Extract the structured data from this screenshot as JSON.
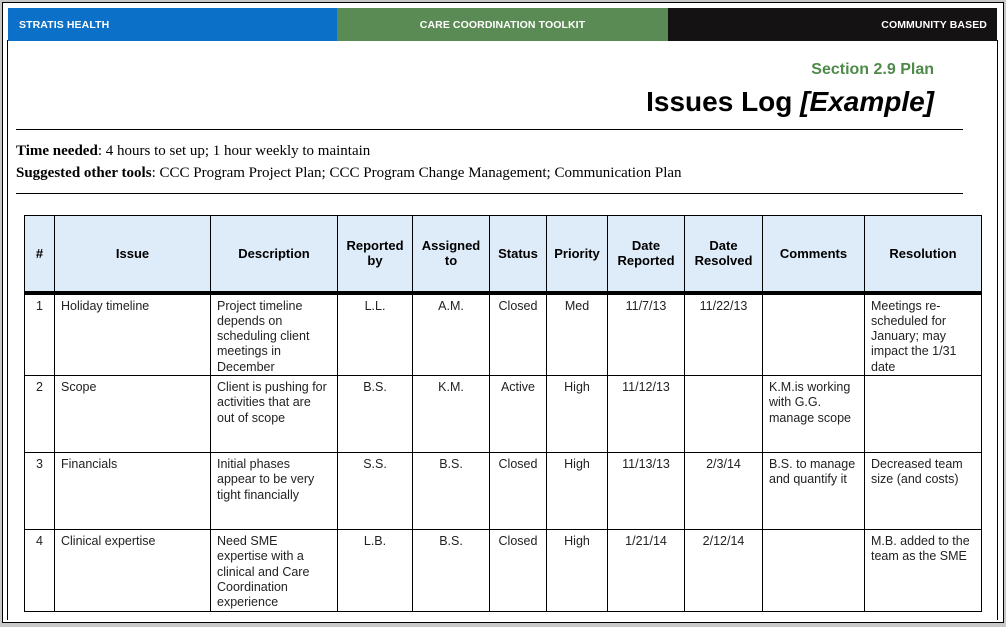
{
  "banner": {
    "left": "STRATIS HEALTH",
    "middle": "CARE COORDINATION TOOLKIT",
    "right": "COMMUNITY BASED",
    "colors": {
      "left": "#0b71c8",
      "middle": "#5b8b55",
      "right": "#141212"
    }
  },
  "header": {
    "section": "Section 2.9 Plan",
    "title": "Issues Log",
    "title_suffix": "[Example]",
    "section_color": "#4f8a4a"
  },
  "meta": {
    "time_label": "Time needed",
    "time_value": ": 4 hours to set up; 1 hour weekly to maintain",
    "tools_label": "Suggested other tools",
    "tools_value": ": CCC Program Project Plan; CCC Program Change Management; Communication Plan"
  },
  "table": {
    "header_bg": "#deebf8",
    "columns": [
      "#",
      "Issue",
      "Description",
      "Reported by",
      "Assigned to",
      "Status",
      "Priority",
      "Date Reported",
      "Date Resolved",
      "Comments",
      "Resolution"
    ],
    "rows": [
      {
        "num": "1",
        "issue": "Holiday timeline",
        "description": "Project timeline depends on scheduling client meetings in December",
        "reported_by": "L.L.",
        "assigned_to": "A.M.",
        "status": "Closed",
        "priority": "Med",
        "date_reported": "11/7/13",
        "date_resolved": "11/22/13",
        "comments": "",
        "resolution": "Meetings re-scheduled for January; may impact the 1/31 date"
      },
      {
        "num": "2",
        "issue": "Scope",
        "description": "Client is pushing for activities that are out of scope",
        "reported_by": "B.S.",
        "assigned_to": "K.M.",
        "status": "Active",
        "priority": "High",
        "date_reported": "11/12/13",
        "date_resolved": "",
        "comments": "K.M.is working with G.G. manage scope",
        "resolution": ""
      },
      {
        "num": "3",
        "issue": "Financials",
        "description": "Initial phases appear to be very tight financially",
        "reported_by": "S.S.",
        "assigned_to": "B.S.",
        "status": "Closed",
        "priority": "High",
        "date_reported": "11/13/13",
        "date_resolved": "2/3/14",
        "comments": "B.S. to manage and quantify it",
        "resolution": "Decreased team size (and costs)"
      },
      {
        "num": "4",
        "issue": "Clinical expertise",
        "description": "Need SME expertise with a clinical and Care Coordination experience",
        "reported_by": "L.B.",
        "assigned_to": "B.S.",
        "status": "Closed",
        "priority": "High",
        "date_reported": "1/21/14",
        "date_resolved": "2/12/14",
        "comments": "",
        "resolution": "M.B. added to the team as the SME"
      }
    ]
  }
}
